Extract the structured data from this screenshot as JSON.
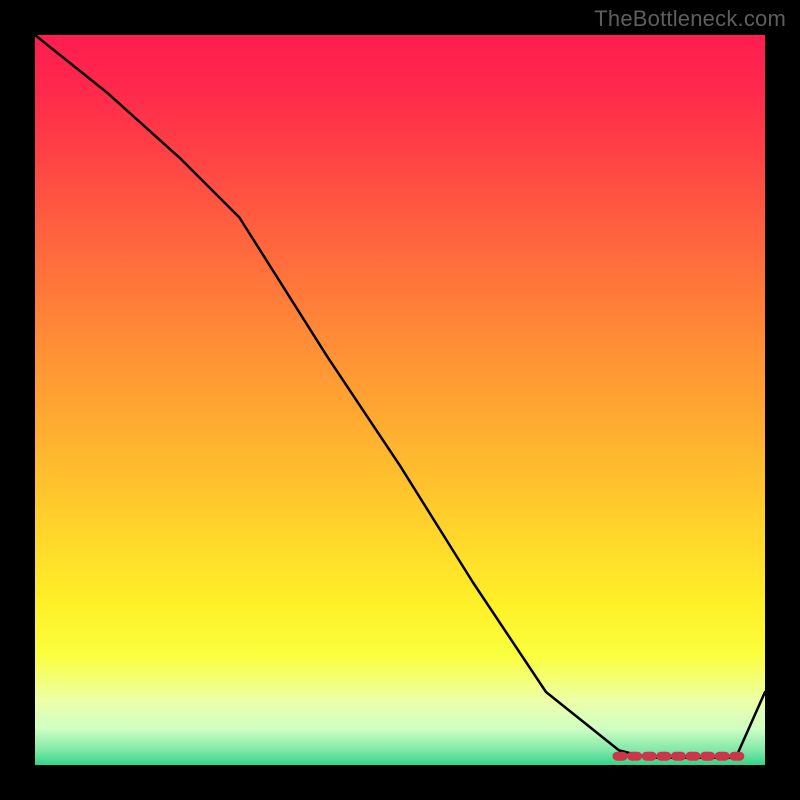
{
  "watermark": "TheBottleneck.com",
  "colors": {
    "frame": "#000000",
    "curve": "#000000",
    "marker": "#cc354a"
  },
  "chart_data": {
    "type": "line",
    "title": "",
    "xlabel": "",
    "ylabel": "",
    "ylim": [
      0,
      100
    ],
    "xlim": [
      0,
      100
    ],
    "grid": false,
    "legend": false,
    "series": [
      {
        "name": "bottleneck-curve",
        "x": [
          0,
          10,
          20,
          28,
          40,
          50,
          60,
          70,
          80,
          84,
          88,
          92,
          96,
          100
        ],
        "values": [
          100,
          92,
          83,
          75,
          56,
          41,
          25,
          10,
          2,
          1,
          1,
          1,
          1,
          10
        ]
      }
    ],
    "markers": {
      "name": "optimal-range",
      "x": [
        80,
        82,
        84,
        86,
        88,
        90,
        92,
        94,
        96
      ],
      "values": [
        1.2,
        1.2,
        1.2,
        1.2,
        1.2,
        1.2,
        1.2,
        1.2,
        1.2
      ]
    }
  }
}
